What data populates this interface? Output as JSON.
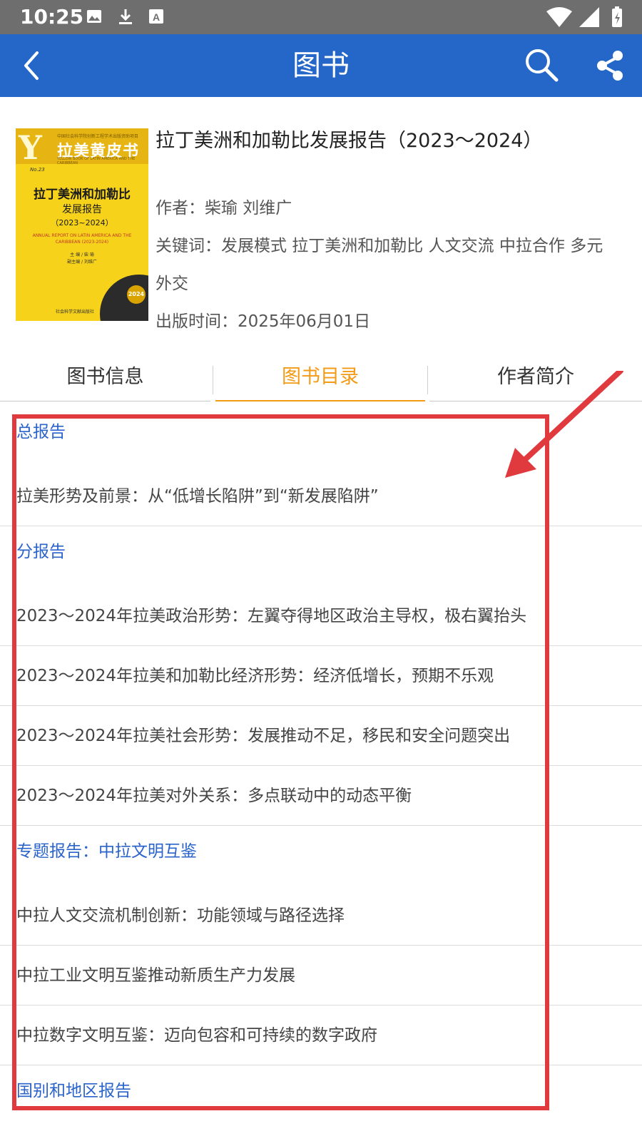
{
  "status_bar": {
    "time": "10:25",
    "icons": [
      "image-icon",
      "download-icon",
      "font-a-icon",
      "wifi-icon",
      "signal-icon",
      "battery-icon"
    ]
  },
  "app_bar": {
    "title": "图书",
    "background": "#2566c9",
    "icons": [
      "back-arrow-icon",
      "search-icon",
      "share-icon"
    ]
  },
  "book": {
    "title": "拉丁美洲和加勒比发展报告（2023～2024）",
    "author_label": "作者：",
    "author_value": "柴瑜  刘维广",
    "keywords_label": "关键词：",
    "keywords_value": "发展模式 拉丁美洲和加勒比 人文交流 中拉合作 多元外交",
    "date_label": "出版时间：",
    "date_value": "2025年06月01日",
    "cover": {
      "series_letter": "Y",
      "series_name": "拉美黄皮书",
      "org_line": "中国社会科学院创新工程学术出版资助项目",
      "series_en": "YELLOW BOOK OF LATIN AMERICA AND THE CARIBBEAN",
      "number": "No.23",
      "title_line1": "拉丁美洲和加勒比",
      "title_line2": "发展报告",
      "title_line3": "（2023~2024）",
      "title_en": "ANNUAL REPORT ON LATIN AMERICA AND THE CARIBBEAN (2023-2024)",
      "editor_line": "主 编 / 柴 瑜",
      "deputy_line": "副主编 / 刘维广",
      "badge": "2024",
      "publisher": "社会科学文献出版社"
    }
  },
  "tabs": [
    {
      "label": "图书信息",
      "active": false
    },
    {
      "label": "图书目录",
      "active": true
    },
    {
      "label": "作者简介",
      "active": false
    }
  ],
  "toc": [
    {
      "type": "section",
      "text": "总报告"
    },
    {
      "type": "chapter",
      "text": "拉美形势及前景：从“低增长陷阱”到“新发展陷阱”"
    },
    {
      "type": "section",
      "text": "分报告"
    },
    {
      "type": "chapter",
      "text": "2023～2024年拉美政治形势：左翼夺得地区政治主导权，极右翼抬头"
    },
    {
      "type": "chapter",
      "text": "2023～2024年拉美和加勒比经济形势：经济低增长，预期不乐观"
    },
    {
      "type": "chapter",
      "text": "2023～2024年拉美社会形势：发展推动不足，移民和安全问题突出"
    },
    {
      "type": "chapter",
      "text": "2023～2024年拉美对外关系：多点联动中的动态平衡"
    },
    {
      "type": "section",
      "text": "专题报告：中拉文明互鉴"
    },
    {
      "type": "chapter",
      "text": "中拉人文交流机制创新：功能领域与路径选择"
    },
    {
      "type": "chapter",
      "text": "中拉工业文明互鉴推动新质生产力发展"
    },
    {
      "type": "chapter",
      "text": "中拉数字文明互鉴：迈向包容和可持续的数字政府"
    },
    {
      "type": "section",
      "text": "国别和地区报告"
    }
  ],
  "colors": {
    "section_text": "#2a63c9",
    "active_tab": "#f39a16",
    "annotation": "#e0393e"
  }
}
